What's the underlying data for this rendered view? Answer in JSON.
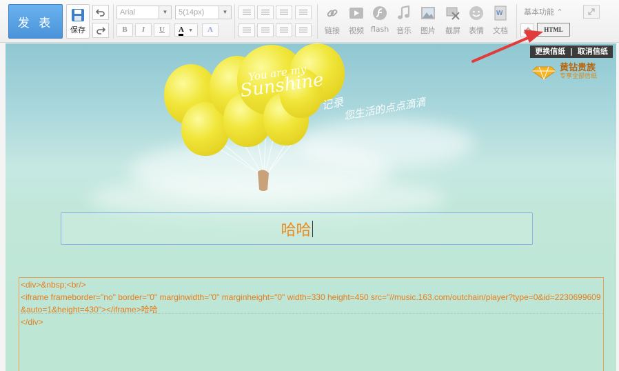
{
  "toolbar": {
    "publish_label": "发 表",
    "save_label": "保存",
    "font_family": "Arial",
    "font_size": "5(14px)",
    "format_buttons": [
      "B",
      "I",
      "U",
      "A",
      "A"
    ],
    "tools": [
      {
        "label": "链接",
        "icon": "link-icon"
      },
      {
        "label": "视频",
        "icon": "video-icon"
      },
      {
        "label": "flash",
        "icon": "flash-icon"
      },
      {
        "label": "音乐",
        "icon": "music-icon"
      },
      {
        "label": "图片",
        "icon": "image-icon"
      },
      {
        "label": "截屏",
        "icon": "screenshot-icon"
      },
      {
        "label": "表情",
        "icon": "emoticon-icon"
      },
      {
        "label": "文档",
        "icon": "document-icon"
      }
    ],
    "basic_functions": "基本功能 ⌃",
    "html_label": "HTML"
  },
  "stationery": {
    "change_label": "更换信纸",
    "divider": "|",
    "cancel_label": "取消信纸",
    "vip_title": "黄钻贵族",
    "vip_subtitle": "专享全部信纸",
    "art_line1": "You are my",
    "art_line2": "Sunshine",
    "art_line3": "记录",
    "art_line4": "您生活的点点滴滴"
  },
  "editor": {
    "title_value": "哈哈",
    "code_content": "<div>&nbsp;<br/>\n<iframe frameborder=\"no\" border=\"0\" marginwidth=\"0\" marginheight=\"0\" width=330 height=450 src=\"//music.163.com/outchain/player?type=0&id=2230699609&auto=1&height=430\"></iframe>哈哈\n</div>"
  },
  "colors": {
    "publish_bg": "#4a93d9",
    "accent_orange": "#e98b20",
    "annotation_arrow": "#e03c3c"
  }
}
